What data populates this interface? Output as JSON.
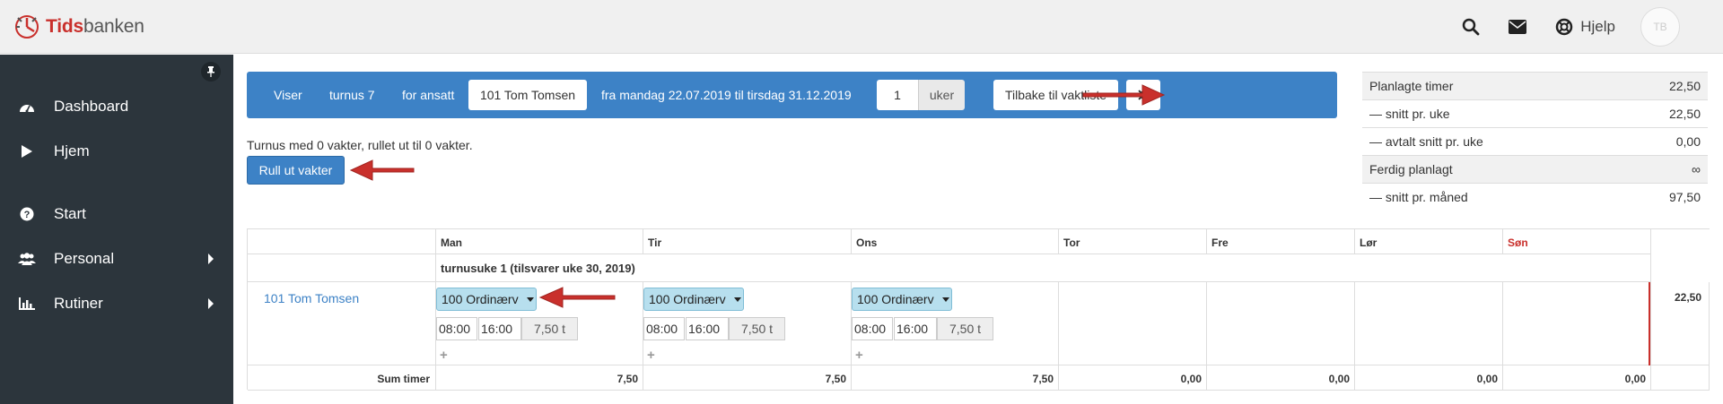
{
  "header": {
    "brand_bold": "Tids",
    "brand_rest": "banken",
    "help_label": "Hjelp",
    "avatar_initials": "TB"
  },
  "sidebar": {
    "items": [
      {
        "label": "Dashboard",
        "icon": "dashboard-icon",
        "has_submenu": false
      },
      {
        "label": "Hjem",
        "icon": "play-icon",
        "has_submenu": false
      },
      {
        "label": "Start",
        "icon": "question-icon",
        "has_submenu": false
      },
      {
        "label": "Personal",
        "icon": "users-icon",
        "has_submenu": true
      },
      {
        "label": "Rutiner",
        "icon": "bar-chart-icon",
        "has_submenu": true
      }
    ]
  },
  "toolbar": {
    "viser": "Viser",
    "turnus": "turnus 7",
    "for_ansatt": "for ansatt",
    "employee": "101 Tom Tomsen",
    "period": "fra mandag 22.07.2019 til tirsdag 31.12.2019",
    "weeks_value": "1",
    "weeks_unit": "uker",
    "back_button": "Tilbake til vaktliste"
  },
  "info_text": "Turnus med 0 vakter, rullet ut til 0 vakter.",
  "rull_button": "Rull ut vakter",
  "stats": [
    {
      "label": "Planlagte timer",
      "value": "22,50"
    },
    {
      "label": "— snitt pr. uke",
      "value": "22,50"
    },
    {
      "label": "— avtalt snitt pr. uke",
      "value": "0,00"
    },
    {
      "label": "Ferdig planlagt",
      "value": "∞"
    },
    {
      "label": "— snitt pr. måned",
      "value": "97,50"
    }
  ],
  "grid": {
    "days": [
      "Man",
      "Tir",
      "Ons",
      "Tor",
      "Fre",
      "Lør",
      "Søn"
    ],
    "week_title": "turnusuke 1 (tilsvarer uke 30, 2019)",
    "employee": "101 Tom Tomsen",
    "row_total": "22,50",
    "shifts": [
      {
        "type": "100 Ordinærv",
        "start": "08:00",
        "end": "16:00",
        "hours": "7,50 t"
      },
      {
        "type": "100 Ordinærv",
        "start": "08:00",
        "end": "16:00",
        "hours": "7,50 t"
      },
      {
        "type": "100 Ordinærv",
        "start": "08:00",
        "end": "16:00",
        "hours": "7,50 t"
      }
    ],
    "sum_label": "Sum timer",
    "sums": [
      "7,50",
      "7,50",
      "7,50",
      "0,00",
      "0,00",
      "0,00",
      "0,00"
    ]
  },
  "colors": {
    "primary": "#3d82c6",
    "sidebar": "#2c353c",
    "accent_red": "#c9302c",
    "shift_bg": "#b7dfee"
  }
}
